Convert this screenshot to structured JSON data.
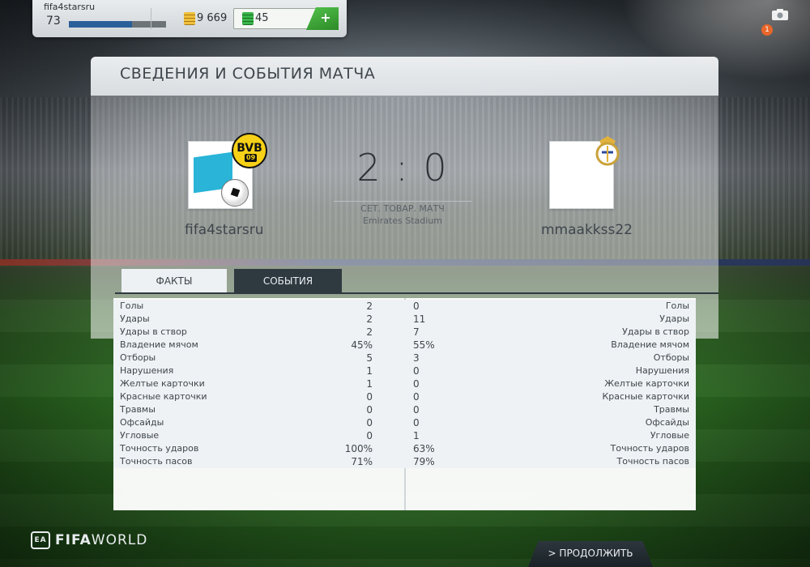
{
  "topbar": {
    "username": "fifa4starsru",
    "level": "73",
    "xp_progress": 0.65,
    "coins": "9 669",
    "points": "45",
    "add_label": "+"
  },
  "notifications": {
    "count": "1"
  },
  "panel": {
    "title": "СВЕДЕНИЯ И СОБЫТИЯ МАТЧА",
    "home_team": "fifa4starsru",
    "away_team": "mmaakkss22",
    "score": "2 : 0",
    "match_type": "СЕТ. ТОВАР. МАТЧ",
    "venue": "Emirates Stadium",
    "home_badge_text": "BVB",
    "home_badge_sub": "09"
  },
  "tabs": [
    {
      "label": "ФАКТЫ",
      "active": true
    },
    {
      "label": "СОБЫТИЯ",
      "active": false
    }
  ],
  "stats": [
    {
      "label": "Голы",
      "home": "2",
      "away": "0"
    },
    {
      "label": "Удары",
      "home": "2",
      "away": "11"
    },
    {
      "label": "Удары в створ",
      "home": "2",
      "away": "7"
    },
    {
      "label": "Владение мячом",
      "home": "45%",
      "away": "55%"
    },
    {
      "label": "Отборы",
      "home": "5",
      "away": "3"
    },
    {
      "label": "Нарушения",
      "home": "1",
      "away": "0"
    },
    {
      "label": "Желтые карточки",
      "home": "1",
      "away": "0"
    },
    {
      "label": "Красные карточки",
      "home": "0",
      "away": "0"
    },
    {
      "label": "Травмы",
      "home": "0",
      "away": "0"
    },
    {
      "label": "Офсайды",
      "home": "0",
      "away": "0"
    },
    {
      "label": "Угловые",
      "home": "0",
      "away": "1"
    },
    {
      "label": "Точность ударов",
      "home": "100%",
      "away": "63%"
    },
    {
      "label": "Точность пасов",
      "home": "71%",
      "away": "79%"
    }
  ],
  "footer": {
    "logo_fifa": "FIFA",
    "logo_world": "WORLD",
    "logo_ea": "EA",
    "continue_label": "> ПРОДОЛЖИТЬ"
  }
}
